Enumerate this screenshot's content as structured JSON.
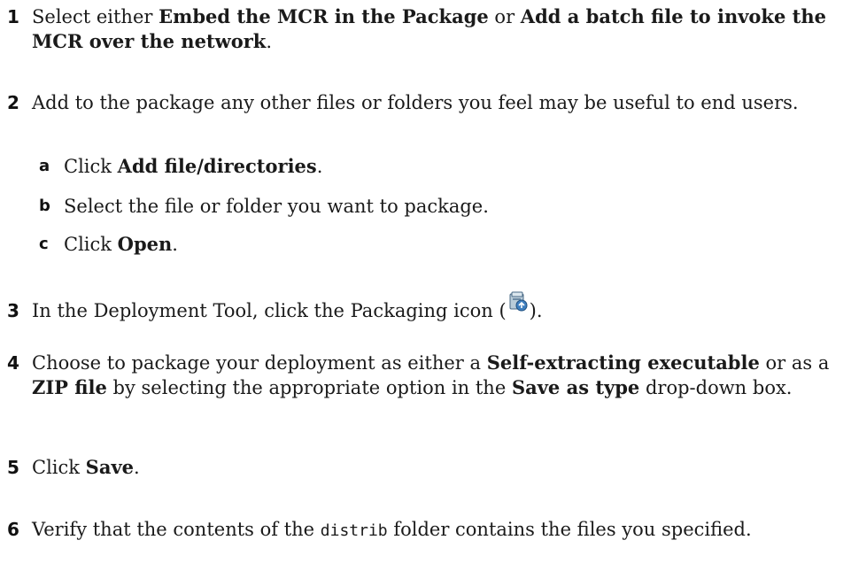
{
  "steps": [
    {
      "num": "1",
      "t1": "Select either ",
      "b1": "Embed the MCR in the Package",
      "t2": " or ",
      "b2": "Add a batch file to invoke the MCR over the network",
      "t3": "."
    },
    {
      "num": "2",
      "t1": "Add to the package any other files or folders you feel may be useful to end users.",
      "sub": [
        {
          "letter": "a",
          "t1": "Click ",
          "b1": "Add file/directories",
          "t2": "."
        },
        {
          "letter": "b",
          "t1": "Select the file or folder you want to package."
        },
        {
          "letter": "c",
          "t1": "Click ",
          "b1": "Open",
          "t2": "."
        }
      ]
    },
    {
      "num": "3",
      "t1": "In the Deployment Tool, click the Packaging icon (",
      "icon": "packaging-icon",
      "t2": ")."
    },
    {
      "num": "4",
      "t1": "Choose to package your deployment as either a ",
      "b1": "Self-extracting executable",
      "t2": " or as a ",
      "b2": "ZIP file",
      "t3": " by selecting the appropriate option in the ",
      "b3": "Save as type",
      "t4": " drop-down box."
    },
    {
      "num": "5",
      "t1": "Click ",
      "b1": "Save",
      "t2": "."
    },
    {
      "num": "6",
      "t1": "Verify that the contents of the ",
      "code": "distrib",
      "t2": " folder contains the files you specified."
    }
  ]
}
